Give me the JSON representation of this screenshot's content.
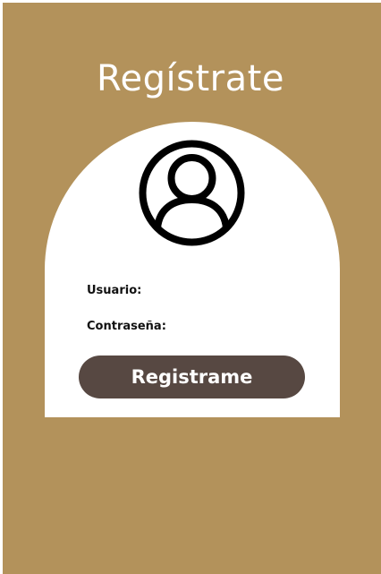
{
  "page": {
    "title": "Regístrate"
  },
  "form": {
    "user_label": "Usuario:",
    "password_label": "Contraseña:",
    "submit_label": "Registrame"
  },
  "icons": {
    "avatar": "user-circle-icon"
  },
  "colors": {
    "background": "#b3925b",
    "card": "#ffffff",
    "button": "#574842",
    "button_text": "#ffffff",
    "title_text": "#ffffff"
  }
}
